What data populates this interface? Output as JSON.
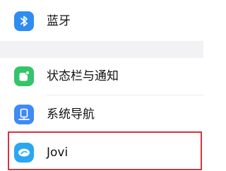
{
  "settings": {
    "items": [
      {
        "label": "蓝牙",
        "icon": "bluetooth-icon",
        "color": "#2f8df2"
      },
      {
        "label": "状态栏与通知",
        "icon": "notification-icon",
        "color": "#35c46a"
      },
      {
        "label": "系统导航",
        "icon": "navigation-icon",
        "color": "#3f8af4"
      },
      {
        "label": "Jovi",
        "icon": "jovi-icon",
        "color": "#2aa7f0"
      }
    ]
  },
  "colors": {
    "highlight": "#d6343c",
    "section_gap": "#f2f2f4"
  }
}
